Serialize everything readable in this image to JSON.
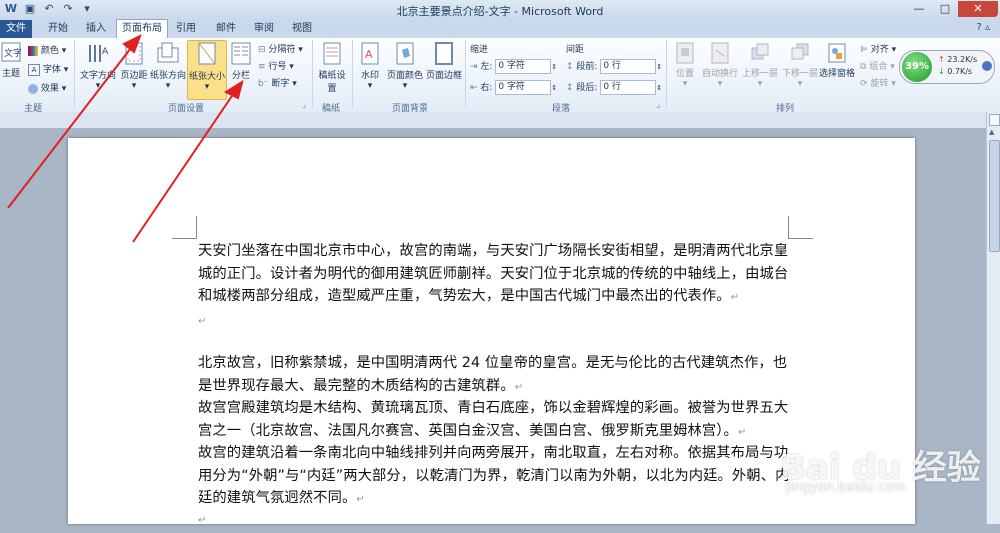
{
  "window": {
    "title": "北京主要景点介绍-文字 - Microsoft Word",
    "controls": [
      "—",
      "□",
      "✕"
    ]
  },
  "tabs": [
    {
      "label": "文件"
    },
    {
      "label": "开始"
    },
    {
      "label": "插入"
    },
    {
      "label": "页面布局"
    },
    {
      "label": "引用"
    },
    {
      "label": "邮件"
    },
    {
      "label": "审阅"
    },
    {
      "label": "视图"
    }
  ],
  "ribbon": {
    "theme_group": {
      "label": "主题",
      "theme": "主题",
      "colors": "颜色",
      "fonts": "字体",
      "effects": "效果"
    },
    "page_setup_group": {
      "label": "页面设置",
      "text_direction": "文字方向",
      "margins": "页边距",
      "orientation": "纸张方向",
      "size": "纸张大小",
      "columns": "分栏",
      "breaks": "分隔符",
      "line_numbers": "行号",
      "hyphenation": "断字"
    },
    "draft_group": {
      "label": "稿纸",
      "draft_settings": "稿纸设置"
    },
    "background_group": {
      "label": "页面背景",
      "watermark": "水印",
      "page_color": "页面颜色",
      "page_border": "页面边框"
    },
    "paragraph_group": {
      "label": "段落",
      "indent_header": "缩进",
      "spacing_header": "间距",
      "left": "左:",
      "right": "右:",
      "before": "段前:",
      "after": "段后:",
      "left_value": "0 字符",
      "right_value": "0 字符",
      "before_value": "0 行",
      "after_value": "0 行"
    },
    "arrange_group": {
      "label": "排列",
      "position": "位置",
      "wrap": "自动换行",
      "bring_forward": "上移一层",
      "send_backward": "下移一层",
      "selection_pane": "选择窗格",
      "align": "对齐",
      "group": "组合",
      "rotate": "旋转"
    }
  },
  "net_widget": {
    "percent": "39%",
    "up": "23.2K/s",
    "down": "0.7K/s"
  },
  "document": {
    "paragraphs": [
      "天安门坐落在中国北京市中心，故宫的南端，与天安门广场隔长安街相望，是明清两代北京皇城的正门。设计者为明代的御用建筑匠师蒯祥。天安门位于北京城的传统的中轴线上，由城台和城楼两部分组成，造型威严庄重，气势宏大，是中国古代城门中最杰出的代表作。",
      "北京故宫，旧称紫禁城，是中国明清两代 24 位皇帝的皇宫。是无与伦比的古代建筑杰作，也是世界现存最大、最完整的木质结构的古建筑群。",
      "故宫宫殿建筑均是木结构、黄琉璃瓦顶、青白石底座，饰以金碧辉煌的彩画。被誉为世界五大宫之一（北京故宫、法国凡尔赛宫、英国白金汉宫、美国白宫、俄罗斯克里姆林宫）。",
      "故宫的建筑沿着一条南北向中轴线排列并向两旁展开，南北取直，左右对称。依据其布局与功用分为“外朝”与“内廷”两大部分，以乾清门为界，乾清门以南为外朝，以北为内廷。外朝、内廷的建筑气氛迥然不同。"
    ],
    "para_mark": "↵"
  },
  "watermark": {
    "main": "Bai du 经验",
    "sub": "jingyan.baidu.com"
  },
  "colors": {
    "file_tab": "#2b5797",
    "annotation_arrow": "#e02020",
    "highlight": "#fbe08a"
  }
}
